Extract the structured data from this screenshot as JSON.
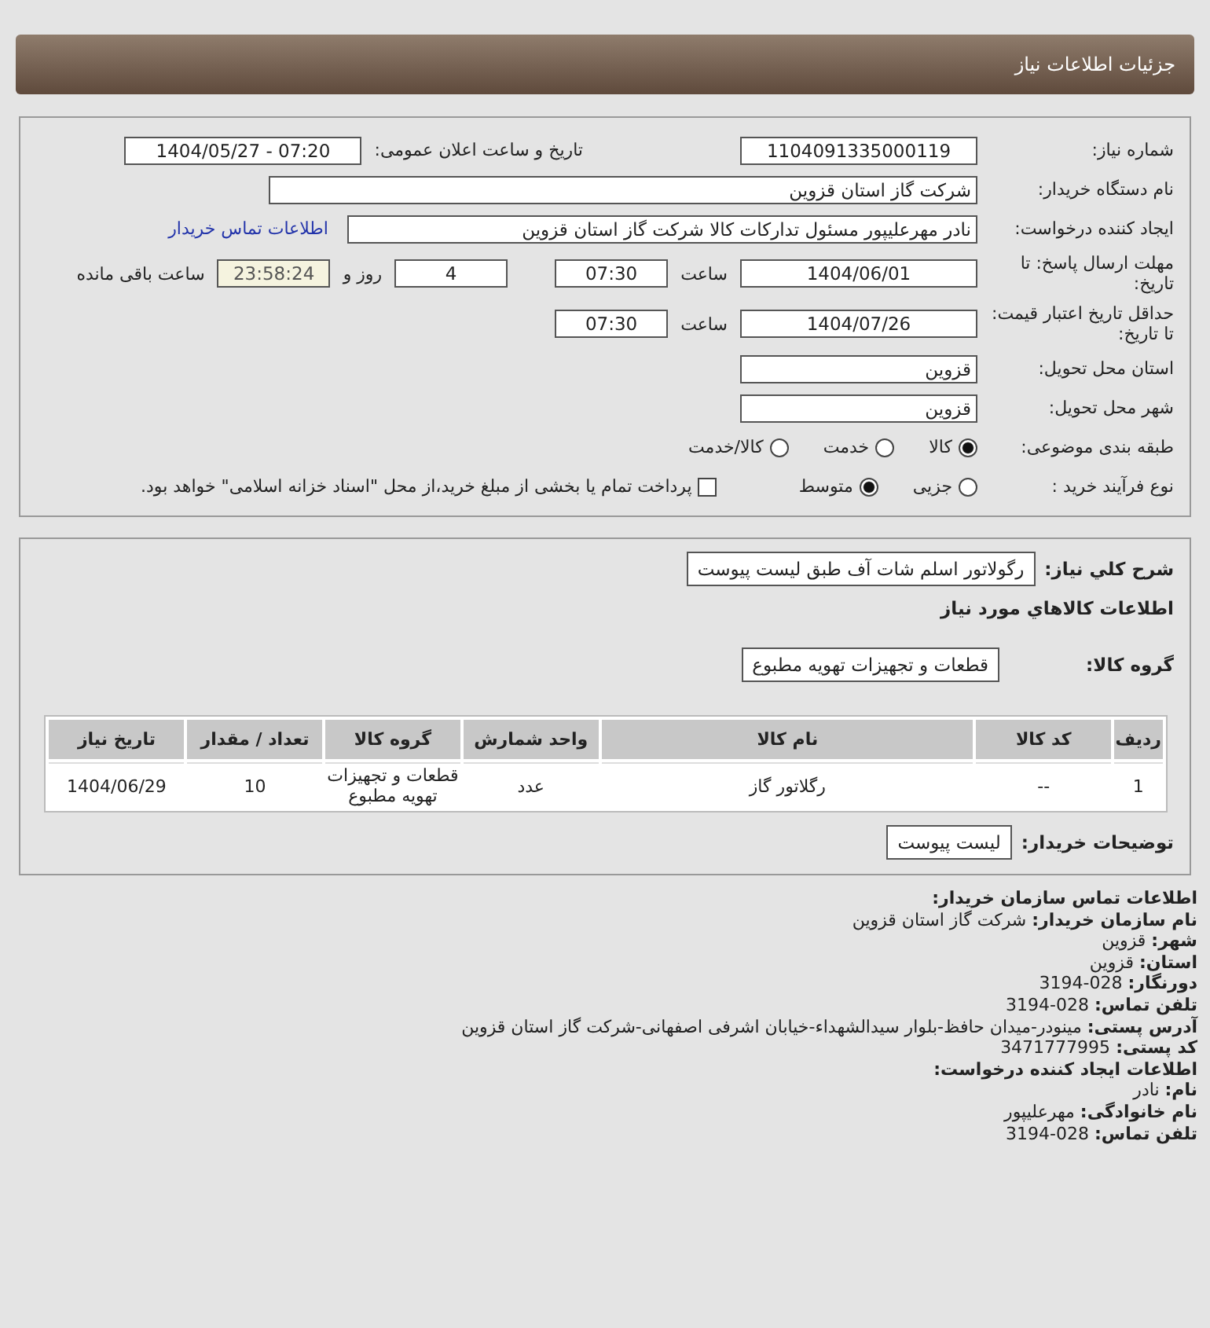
{
  "header": {
    "title": "جزئیات اطلاعات نیاز"
  },
  "need": {
    "number_label": "شماره نیاز:",
    "number": "1104091335000119",
    "announce_label": "تاریخ و ساعت اعلان عمومی:",
    "announce": "1404/05/27 - 07:20",
    "buyer_label": "نام دستگاه خریدار:",
    "buyer": "شرکت گاز استان قزوین",
    "creator_label": "ایجاد کننده درخواست:",
    "creator": "نادر مهرعلیپور مسئول تدارکات کالا شرکت گاز استان قزوین",
    "contact_link": "اطلاعات تماس خریدار",
    "deadline_label": "مهلت ارسال پاسخ: تا تاریخ:",
    "deadline_date": "1404/06/01",
    "time_label": "ساعت",
    "deadline_time": "07:30",
    "days": "4",
    "days_label": "روز و",
    "remaining": "23:58:24",
    "remaining_label": "ساعت باقی مانده",
    "validity_label": "حداقل تاریخ اعتبار قیمت: تا تاریخ:",
    "validity_date": "1404/07/26",
    "validity_time_label": "ساعت",
    "validity_time": "07:30",
    "province_label": "استان محل تحویل:",
    "province": "قزوین",
    "city_label": "شهر محل تحویل:",
    "city": "قزوین",
    "category_label": "طبقه بندی موضوعی:",
    "categories": [
      {
        "label": "کالا",
        "selected": true
      },
      {
        "label": "خدمت",
        "selected": false
      },
      {
        "label": "کالا/خدمت",
        "selected": false
      }
    ],
    "process_label": "نوع فرآیند خرید :",
    "processes": [
      {
        "label": "جزیی",
        "selected": false
      },
      {
        "label": "متوسط",
        "selected": true
      }
    ],
    "payment": {
      "checked": false,
      "label": "پرداخت تمام یا بخشی از مبلغ خرید،از محل \"اسناد خزانه اسلامی\" خواهد بود."
    }
  },
  "goods": {
    "summary_label": "شرح كلي نياز:",
    "summary": "رگولاتور اسلم شات آف طبق لیست پیوست",
    "section_title": "اطلاعات كالاهاي مورد نياز",
    "group_label": "گروه کالا:",
    "group": "قطعات و تجهیزات تهویه مطبوع",
    "table": {
      "columns": [
        "ردیف",
        "کد کالا",
        "نام کالا",
        "واحد شمارش",
        "گروه کالا",
        "تعداد / مقدار",
        "تاریخ نیاز"
      ],
      "rows": [
        [
          "1",
          "--",
          "رگلاتور گاز",
          "عدد",
          "قطعات و تجهیزات تهویه مطبوع",
          "10",
          "1404/06/29"
        ]
      ]
    },
    "notes_label": "توضیحات خریدار:",
    "notes": "لیست پیوست"
  },
  "contact": [
    {
      "kind": "heading",
      "label": "اطلاعات تماس سازمان خریدار:"
    },
    {
      "kind": "field",
      "label": "نام سازمان خریدار:",
      "value": "شرکت گاز استان قزوین"
    },
    {
      "kind": "field",
      "label": "شهر:",
      "value": "قزوین"
    },
    {
      "kind": "field",
      "label": "استان:",
      "value": "قزوین"
    },
    {
      "kind": "field",
      "label": "دورنگار:",
      "value": "028-3194"
    },
    {
      "kind": "field",
      "label": "تلفن تماس:",
      "value": "028-3194"
    },
    {
      "kind": "field",
      "label": "آدرس پستی:",
      "value": "مینودر-میدان حافظ-بلوار سیدالشهداء-خیابان اشرفی اصفهانی-شرکت گاز استان قزوین"
    },
    {
      "kind": "field",
      "label": "کد پستی:",
      "value": "3471777995"
    },
    {
      "kind": "heading",
      "label": "اطلاعات ایجاد کننده درخواست:"
    },
    {
      "kind": "field",
      "label": "نام:",
      "value": "نادر"
    },
    {
      "kind": "field",
      "label": "نام خانوادگی:",
      "value": "مهرعلیپور"
    },
    {
      "kind": "field",
      "label": "تلفن تماس:",
      "value": "028-3194"
    }
  ]
}
